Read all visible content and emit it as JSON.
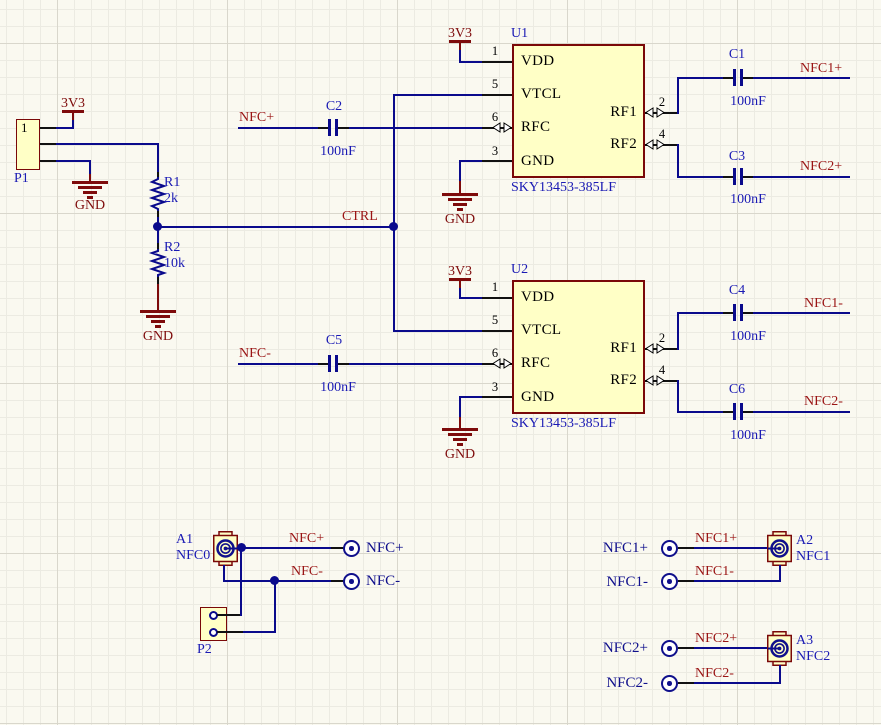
{
  "u1": {
    "ref": "U1",
    "part": "SKY13453-385LF",
    "pins": {
      "vdd": {
        "num": "1",
        "name": "VDD"
      },
      "vtcl": {
        "num": "5",
        "name": "VTCL"
      },
      "rfc": {
        "num": "6",
        "name": "RFC"
      },
      "gnd": {
        "num": "3",
        "name": "GND"
      },
      "rf1": {
        "num": "2",
        "name": "RF1"
      },
      "rf2": {
        "num": "4",
        "name": "RF2"
      }
    }
  },
  "u2": {
    "ref": "U2",
    "part": "SKY13453-385LF",
    "pins": {
      "vdd": {
        "num": "1",
        "name": "VDD"
      },
      "vtcl": {
        "num": "5",
        "name": "VTCL"
      },
      "rfc": {
        "num": "6",
        "name": "RFC"
      },
      "gnd": {
        "num": "3",
        "name": "GND"
      },
      "rf1": {
        "num": "2",
        "name": "RF1"
      },
      "rf2": {
        "num": "4",
        "name": "RF2"
      }
    }
  },
  "r1": {
    "ref": "R1",
    "value": "2k"
  },
  "r2": {
    "ref": "R2",
    "value": "10k"
  },
  "c1": {
    "ref": "C1",
    "value": "100nF"
  },
  "c2": {
    "ref": "C2",
    "value": "100nF"
  },
  "c3": {
    "ref": "C3",
    "value": "100nF"
  },
  "c4": {
    "ref": "C4",
    "value": "100nF"
  },
  "c5": {
    "ref": "C5",
    "value": "100nF"
  },
  "c6": {
    "ref": "C6",
    "value": "100nF"
  },
  "p1": {
    "ref": "P1",
    "pin1": "1"
  },
  "p2": {
    "ref": "P2"
  },
  "a1": {
    "ref": "A1",
    "net": "NFC0"
  },
  "a2": {
    "ref": "A2",
    "net": "NFC1"
  },
  "a3": {
    "ref": "A3",
    "net": "NFC2"
  },
  "power": {
    "rail": "3V3",
    "gnd": "GND"
  },
  "nets": {
    "nfc_p": "NFC+",
    "nfc_m": "NFC-",
    "ctrl": "CTRL",
    "nfc1_p": "NFC1+",
    "nfc1_m": "NFC1-",
    "nfc2_p": "NFC2+",
    "nfc2_m": "NFC2-"
  },
  "ports": {
    "nfc_p": "NFC+",
    "nfc_m": "NFC-",
    "nfc1_p": "NFC1+",
    "nfc1_m": "NFC1-",
    "nfc2_p": "NFC2+",
    "nfc2_m": "NFC2-"
  },
  "colors": {
    "wire": "#0a0a8c",
    "net": "#9a1414",
    "maroon": "#7e0b0b",
    "des": "#1a1ab4",
    "port": "#10108c",
    "fill": "#ffffc6",
    "border": "#7a0808",
    "pin": "#111111"
  }
}
